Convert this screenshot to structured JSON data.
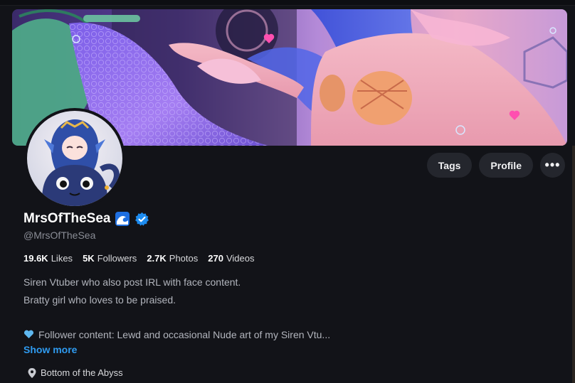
{
  "profile": {
    "name": "MrsOfTheSea",
    "handle": "@MrsOfTheSea"
  },
  "actions": {
    "tags_label": "Tags",
    "profile_label": "Profile",
    "more_label": "•••"
  },
  "stats": [
    {
      "value": "19.6K",
      "label": "Likes"
    },
    {
      "value": "5K",
      "label": "Followers"
    },
    {
      "value": "2.7K",
      "label": "Photos"
    },
    {
      "value": "270",
      "label": "Videos"
    }
  ],
  "bio": {
    "line1": "Siren Vtuber who also post IRL with face content.",
    "line2": "Bratty girl who loves to be praised.",
    "line3": "Follower content: Lewd and occasional Nude art of my Siren Vtu..."
  },
  "show_more_label": "Show more",
  "location": "Bottom of the Abyss",
  "icons": {
    "verified": "verified-badge-icon",
    "wave": "water-wave-emoji-icon",
    "heart": "blue-heart-emoji-icon",
    "pin": "location-pin-icon"
  },
  "colors": {
    "background": "#121318",
    "accent_link": "#2f9bf0",
    "verified": "#1d8cf0",
    "pill_bg": "#24262d"
  }
}
